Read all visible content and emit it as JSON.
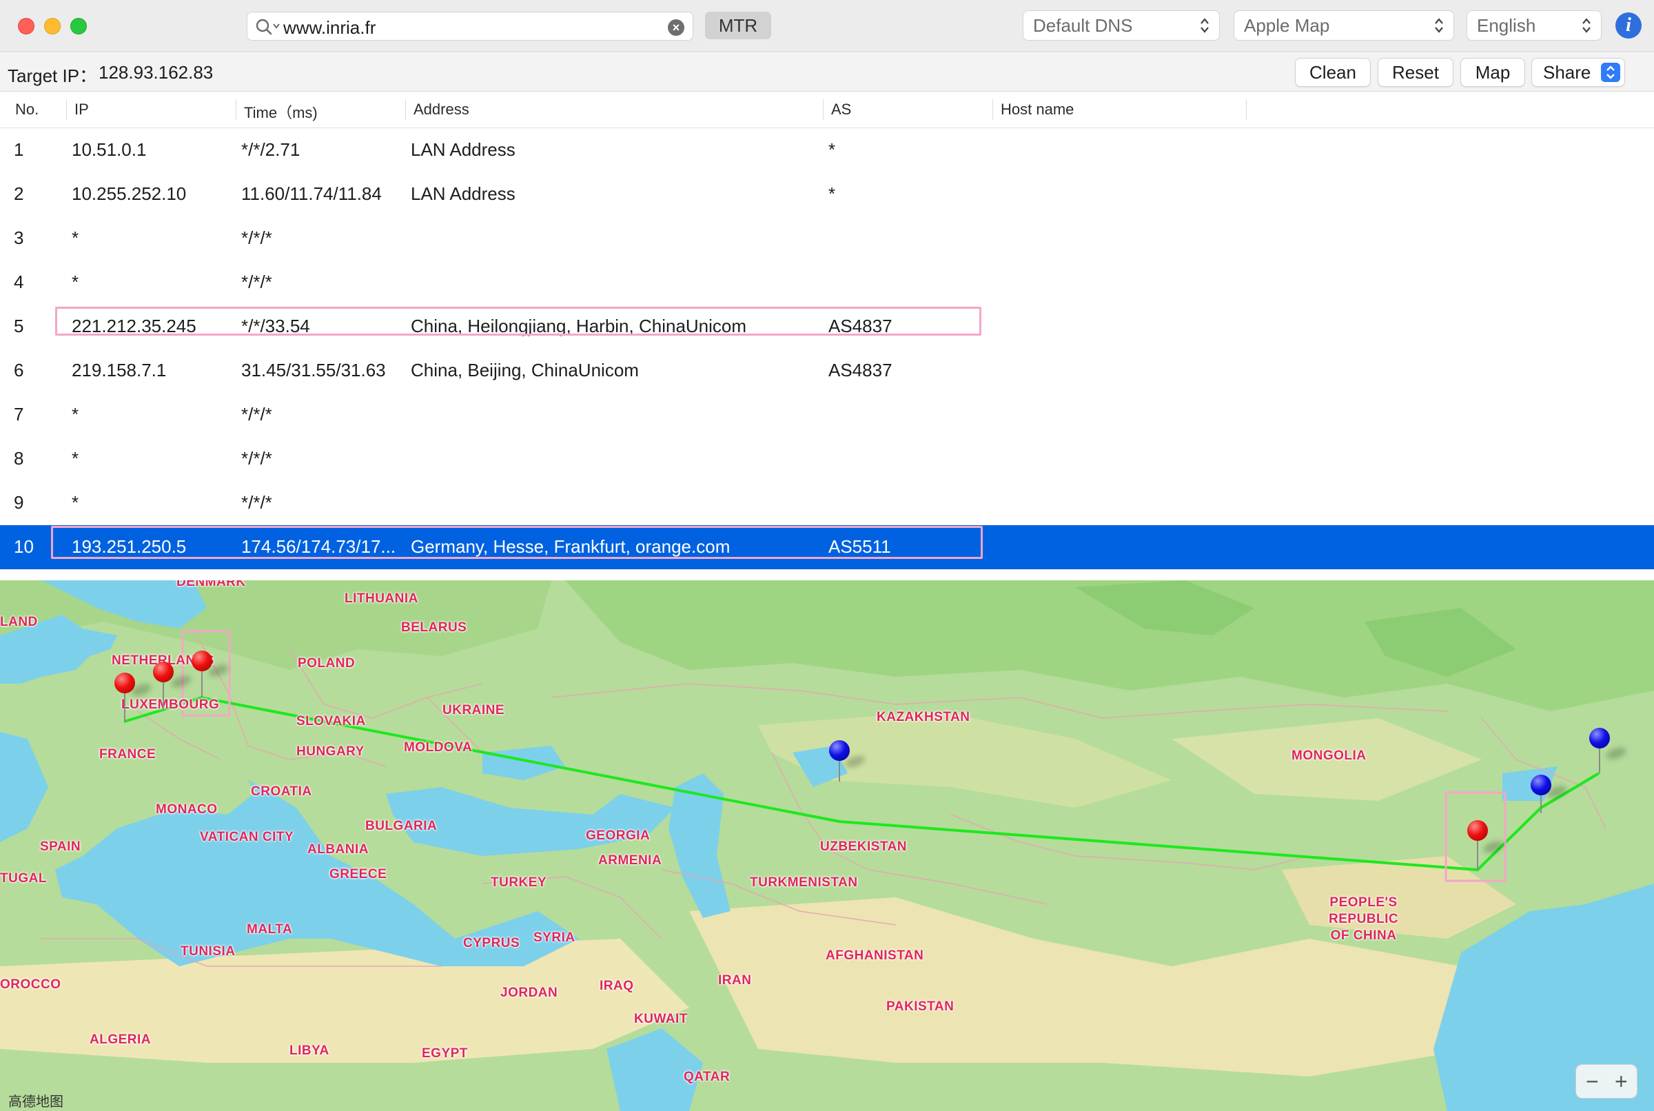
{
  "toolbar": {
    "search_value": "www.inria.fr",
    "mode_button": "MTR",
    "dns_select": "Default DNS",
    "map_select": "Apple Map",
    "language_select": "English"
  },
  "target": {
    "label": "Target IP：",
    "ip": "128.93.162.83",
    "buttons": {
      "clean": "Clean",
      "reset": "Reset",
      "map": "Map",
      "share": "Share"
    }
  },
  "table": {
    "columns": [
      "No.",
      "IP",
      "Time（ms)",
      "Address",
      "AS",
      "Host name"
    ],
    "rows": [
      {
        "no": "1",
        "ip": "10.51.0.1",
        "time": "*/*/2.71",
        "address": "LAN Address",
        "as": "*"
      },
      {
        "no": "2",
        "ip": "10.255.252.10",
        "time": "11.60/11.74/11.84",
        "address": "LAN Address",
        "as": "*"
      },
      {
        "no": "3",
        "ip": "*",
        "time": "*/*/*",
        "address": "",
        "as": ""
      },
      {
        "no": "4",
        "ip": "*",
        "time": "*/*/*",
        "address": "",
        "as": ""
      },
      {
        "no": "5",
        "ip": "221.212.35.245",
        "time": "*/*/33.54",
        "address": "China, Heilongjiang, Harbin, ChinaUnicom",
        "as": "AS4837"
      },
      {
        "no": "6",
        "ip": "219.158.7.1",
        "time": "31.45/31.55/31.63",
        "address": "China, Beijing, ChinaUnicom",
        "as": "AS4837"
      },
      {
        "no": "7",
        "ip": "*",
        "time": "*/*/*",
        "address": "",
        "as": ""
      },
      {
        "no": "8",
        "ip": "*",
        "time": "*/*/*",
        "address": "",
        "as": ""
      },
      {
        "no": "9",
        "ip": "*",
        "time": "*/*/*",
        "address": "",
        "as": ""
      },
      {
        "no": "10",
        "ip": "193.251.250.5",
        "time": "174.56/174.73/17...",
        "address": "Germany, Hesse, Frankfurt, orange.com",
        "as": "AS5511"
      }
    ],
    "selected_row": "10"
  },
  "map": {
    "brand": "高德地图",
    "zoom_out": "−",
    "zoom_in": "+",
    "labels": {
      "denmark": "DENMARK",
      "lithuania": "LITHUANIA",
      "belarus": "BELARUS",
      "land": "LAND",
      "netherlands": "NETHERLANDS",
      "poland": "POLAND",
      "luxembourg": "LUXEMBOURG",
      "ukraine": "UKRAINE",
      "slovakia": "SLOVAKIA",
      "kazakhstan": "KAZAKHSTAN",
      "france": "FRANCE",
      "hungary": "HUNGARY",
      "moldova": "MOLDOVA",
      "mongolia": "MONGOLIA",
      "croatia": "CROATIA",
      "monaco": "MONACO",
      "bulgaria": "BULGARIA",
      "spain": "SPAIN",
      "vatican": "VATICAN CITY",
      "albania": "ALBANIA",
      "georgia": "GEORGIA",
      "uzbekistan": "UZBEKISTAN",
      "armenia": "ARMENIA",
      "greece": "GREECE",
      "tugal": "TUGAL",
      "turkey": "TURKEY",
      "turkmenistan": "TURKMENISTAN",
      "china": "PEOPLE'S\nREPUBLIC\nOF CHINA",
      "malta": "MALTA",
      "cyprus": "CYPRUS",
      "syria": "SYRIA",
      "tunisia": "TUNISIA",
      "afghanistan": "AFGHANISTAN",
      "iran": "IRAN",
      "orocco": "OROCCO",
      "jordan": "JORDAN",
      "iraq": "IRAQ",
      "pakistan": "PAKISTAN",
      "kuwait": "KUWAIT",
      "algeria": "ALGERIA",
      "libya": "LIBYA",
      "egypt": "EGYPT",
      "qatar": "QATAR"
    },
    "colors": {
      "route": "#1ee81e",
      "water": "#79cfe9",
      "land": "#b4dc98",
      "highlight": "#f3a6c8"
    }
  }
}
